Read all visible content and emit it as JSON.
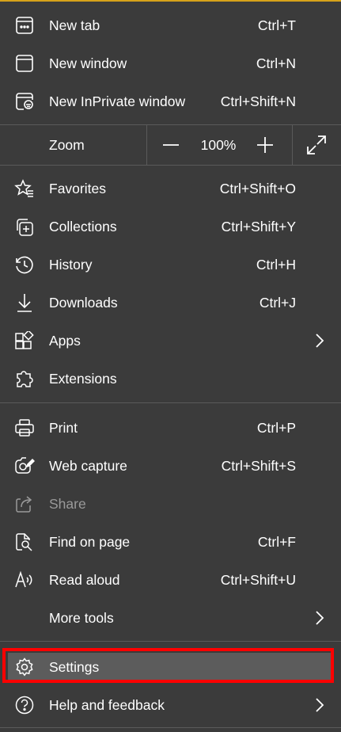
{
  "menu": {
    "new_tab": {
      "label": "New tab",
      "shortcut": "Ctrl+T"
    },
    "new_window": {
      "label": "New window",
      "shortcut": "Ctrl+N"
    },
    "new_inprivate": {
      "label": "New InPrivate window",
      "shortcut": "Ctrl+Shift+N"
    },
    "zoom": {
      "label": "Zoom",
      "value": "100%"
    },
    "favorites": {
      "label": "Favorites",
      "shortcut": "Ctrl+Shift+O"
    },
    "collections": {
      "label": "Collections",
      "shortcut": "Ctrl+Shift+Y"
    },
    "history": {
      "label": "History",
      "shortcut": "Ctrl+H"
    },
    "downloads": {
      "label": "Downloads",
      "shortcut": "Ctrl+J"
    },
    "apps": {
      "label": "Apps"
    },
    "extensions": {
      "label": "Extensions"
    },
    "print": {
      "label": "Print",
      "shortcut": "Ctrl+P"
    },
    "web_capture": {
      "label": "Web capture",
      "shortcut": "Ctrl+Shift+S"
    },
    "share": {
      "label": "Share"
    },
    "find_on_page": {
      "label": "Find on page",
      "shortcut": "Ctrl+F"
    },
    "read_aloud": {
      "label": "Read aloud",
      "shortcut": "Ctrl+Shift+U"
    },
    "more_tools": {
      "label": "More tools"
    },
    "settings": {
      "label": "Settings"
    },
    "help_feedback": {
      "label": "Help and feedback"
    }
  },
  "colors": {
    "background": "#3b3b3b",
    "text": "#ffffff",
    "disabled_text": "#9a9a9a",
    "highlight_border": "#ff0000",
    "hover_background": "#5c5c5c"
  }
}
